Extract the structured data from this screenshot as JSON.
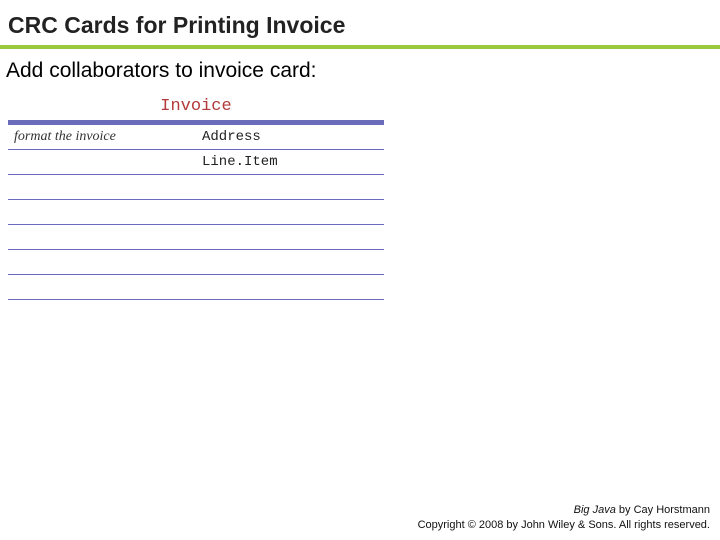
{
  "title": "CRC Cards for Printing Invoice",
  "subtitle": "Add collaborators to invoice card:",
  "card": {
    "class_name": "Invoice",
    "responsibilities": [
      "format the invoice",
      "",
      "",
      "",
      "",
      "",
      ""
    ],
    "collaborators": [
      "Address",
      "Line.Item",
      "",
      "",
      "",
      "",
      ""
    ]
  },
  "footer": {
    "book": "Big Java",
    "by": " by Cay Horstmann",
    "copyright": "Copyright © 2008 by John Wiley & Sons. All rights reserved."
  }
}
